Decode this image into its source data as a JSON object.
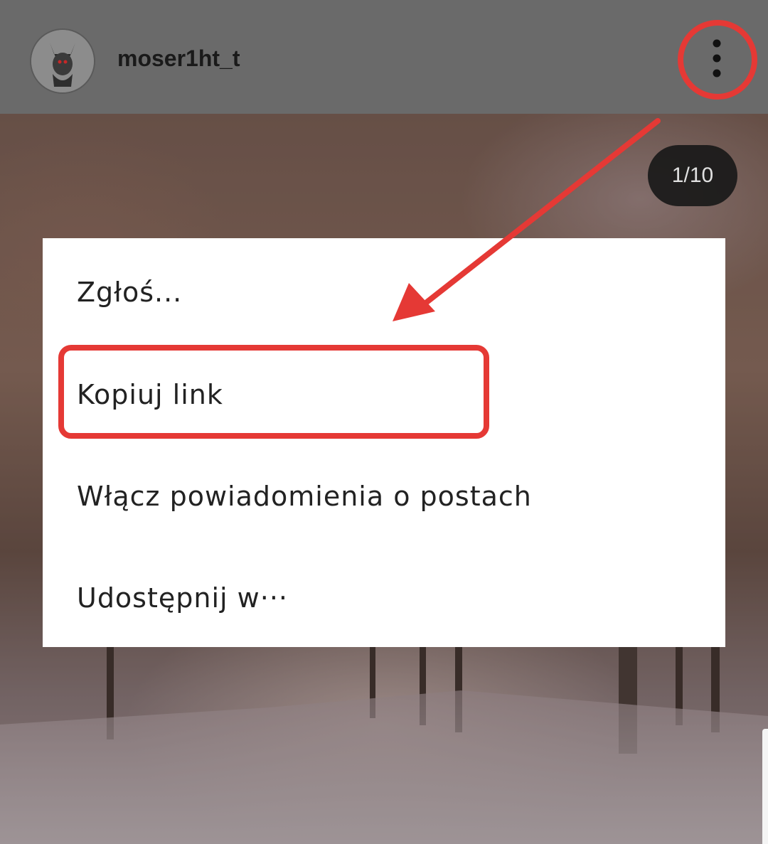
{
  "header": {
    "username": "moser1ht_t",
    "avatar_icon": "devil-avatar-icon",
    "more_icon": "vertical-dots-icon"
  },
  "carousel": {
    "counter": "1/10"
  },
  "menu": {
    "items": [
      {
        "label": "Zgłoś..."
      },
      {
        "label": "Kopiuj link"
      },
      {
        "label": "Włącz powiadomienia o postach"
      },
      {
        "label": "Udostępnij w···"
      }
    ]
  },
  "annotations": {
    "color": "#e53935"
  }
}
